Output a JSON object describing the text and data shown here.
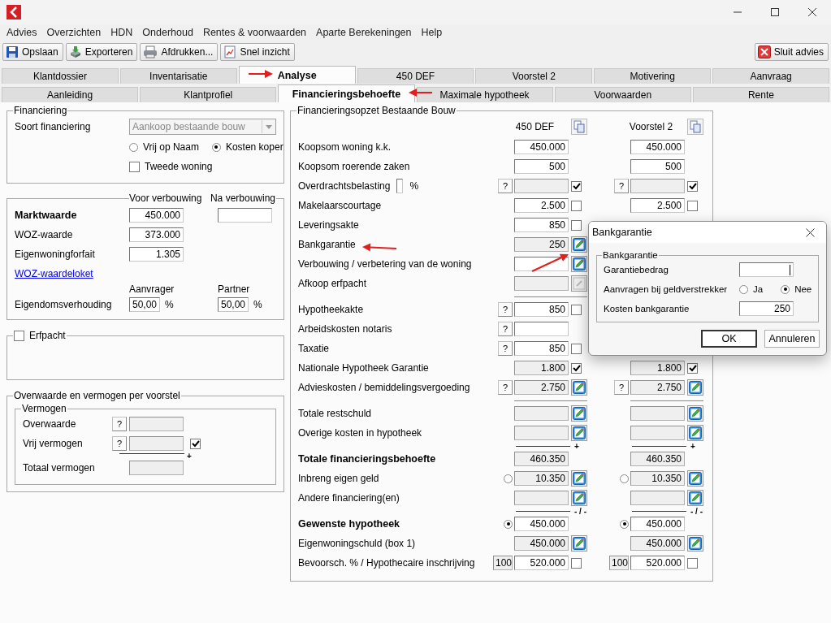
{
  "menu": [
    "Advies",
    "Overzichten",
    "HDN",
    "Onderhoud",
    "Rentes & voorwaarden",
    "Aparte Berekeningen",
    "Help"
  ],
  "toolbar": [
    {
      "label": "Opslaan"
    },
    {
      "label": "Exporteren"
    },
    {
      "label": "Afdrukken..."
    },
    {
      "label": "Snel inzicht"
    }
  ],
  "close_advice": {
    "label": "Sluit advies"
  },
  "tabs": [
    {
      "label": "Klantdossier",
      "selected": false
    },
    {
      "label": "Inventarisatie",
      "selected": false
    },
    {
      "label": "Analyse",
      "selected": true
    },
    {
      "label": "450 DEF",
      "selected": false
    },
    {
      "label": "Voorstel 2",
      "selected": false
    },
    {
      "label": "Motivering",
      "selected": false
    },
    {
      "label": "Aanvraag",
      "selected": false
    }
  ],
  "subtabs": [
    {
      "label": "Aanleiding",
      "selected": false
    },
    {
      "label": "Klantprofiel",
      "selected": false
    },
    {
      "label": "Financieringsbehoefte",
      "selected": true
    },
    {
      "label": "Maximale hypotheek",
      "selected": false
    },
    {
      "label": "Voorwaarden",
      "selected": false
    },
    {
      "label": "Rente",
      "selected": false
    }
  ],
  "financiering": {
    "title": "Financiering",
    "soort_label": "Soort financiering",
    "soort_value": "Aankoop bestaande bouw",
    "options": [
      {
        "label": "Vrij op Naam",
        "selected": false
      },
      {
        "label": "Kosten koper",
        "selected": true
      }
    ],
    "tweede_woning": {
      "label": "Tweede woning",
      "checked": false
    }
  },
  "waarde": {
    "voor_label": "Voor verbouwing",
    "na_label": "Na verbouwing",
    "marktwaarde": {
      "label": "Marktwaarde",
      "value": "450.000"
    },
    "woz": {
      "label": "WOZ-waarde",
      "value": "373.000"
    },
    "forfait": {
      "label": "Eigenwoningforfait",
      "value": "1.305"
    },
    "link": "WOZ-waardeloket",
    "eigendom": {
      "label": "Eigendomsverhouding",
      "aanvrager": {
        "label": "Aanvrager",
        "value": "50,00",
        "unit": "%"
      },
      "partner": {
        "label": "Partner",
        "value": "50,00",
        "unit": "%"
      }
    }
  },
  "erfpacht": {
    "label": "Erfpacht",
    "checked": false
  },
  "overwaarde": {
    "title": "Overwaarde en vermogen per voorstel",
    "group": "Vermogen",
    "overwaarde": {
      "label": "Overwaarde",
      "help": "?"
    },
    "vrij": {
      "label": "Vrij vermogen",
      "help": "?",
      "checked": true,
      "operator": "+"
    },
    "totaal": {
      "label": "Totaal vermogen"
    }
  },
  "opzet": {
    "title": "Financieringsopzet Bestaande Bouw",
    "columns": [
      {
        "name": "450 DEF"
      },
      {
        "name": "Voorstel 2"
      }
    ],
    "rows": [
      {
        "kind": "item",
        "label": "Koopsom woning k.k.",
        "cells": [
          {
            "field": {
              "kind": "input",
              "value": "450.000"
            }
          },
          {
            "field": {
              "kind": "input",
              "value": "450.000"
            }
          }
        ]
      },
      {
        "kind": "item",
        "label": "Koopsom roerende zaken",
        "cells": [
          {
            "field": {
              "kind": "input",
              "value": "500"
            }
          },
          {
            "field": {
              "kind": "input",
              "value": "500"
            }
          }
        ]
      },
      {
        "kind": "item",
        "label": "Overdrachtsbelasting",
        "percent_field": {
          "unit": "%"
        },
        "cells": [
          {
            "prefix": {
              "kind": "help",
              "text": "?"
            },
            "field": {
              "kind": "readonly"
            },
            "suffix": {
              "kind": "checkbox",
              "checked": true
            }
          },
          {
            "prefix": {
              "kind": "help",
              "text": "?"
            },
            "field": {
              "kind": "readonly"
            },
            "suffix": {
              "kind": "checkbox",
              "checked": true
            }
          }
        ]
      },
      {
        "kind": "item",
        "label": "Makelaarscourtage",
        "cells": [
          {
            "field": {
              "kind": "input",
              "value": "2.500"
            },
            "suffix": {
              "kind": "checkbox",
              "checked": false
            }
          },
          {
            "field": {
              "kind": "input",
              "value": "2.500"
            },
            "suffix": {
              "kind": "checkbox",
              "checked": false
            }
          }
        ]
      },
      {
        "kind": "item",
        "label": "Leveringsakte",
        "cells": [
          {
            "field": {
              "kind": "input",
              "value": "850"
            },
            "suffix": {
              "kind": "checkbox",
              "checked": false
            }
          },
          null
        ]
      },
      {
        "kind": "item",
        "label": "Bankgarantie",
        "cells": [
          {
            "field": {
              "kind": "readonly",
              "value": "250"
            },
            "suffix": {
              "kind": "edit",
              "disabled": false
            }
          },
          null
        ]
      },
      {
        "kind": "item",
        "label": "Verbouwing / verbetering van de woning",
        "cells": [
          {
            "field": {
              "kind": "input"
            },
            "suffix": {
              "kind": "edit",
              "disabled": false
            }
          },
          null
        ]
      },
      {
        "kind": "item",
        "label": "Afkoop erfpacht",
        "cells": [
          {
            "field": {
              "kind": "readonly"
            },
            "suffix": {
              "kind": "edit",
              "disabled": true
            }
          },
          null
        ]
      },
      {
        "kind": "separator",
        "cells": [
          {
            "kind": "line"
          },
          null
        ]
      },
      {
        "kind": "item",
        "label": "Hypotheekakte",
        "cells": [
          {
            "prefix": {
              "kind": "help",
              "text": "?"
            },
            "field": {
              "kind": "input",
              "value": "850"
            },
            "suffix": {
              "kind": "checkbox",
              "checked": false
            }
          },
          null
        ]
      },
      {
        "kind": "item",
        "label": "Arbeidskosten notaris",
        "cells": [
          {
            "prefix": {
              "kind": "help",
              "text": "?"
            },
            "field": {
              "kind": "input"
            }
          },
          null
        ]
      },
      {
        "kind": "item",
        "label": "Taxatie",
        "cells": [
          {
            "prefix": {
              "kind": "help",
              "text": "?"
            },
            "field": {
              "kind": "input",
              "value": "850"
            },
            "suffix": {
              "kind": "checkbox",
              "checked": false
            }
          },
          null
        ]
      },
      {
        "kind": "item",
        "label": "Nationale Hypotheek Garantie",
        "cells": [
          {
            "field": {
              "kind": "readonly",
              "value": "1.800"
            },
            "suffix": {
              "kind": "checkbox",
              "checked": true
            }
          },
          {
            "field": {
              "kind": "readonly",
              "value": "1.800"
            },
            "suffix": {
              "kind": "checkbox",
              "checked": true
            }
          }
        ]
      },
      {
        "kind": "item",
        "label": "Advieskosten / bemiddelingsvergoeding",
        "cells": [
          {
            "prefix": {
              "kind": "help",
              "text": "?"
            },
            "field": {
              "kind": "readonly",
              "value": "2.750"
            },
            "suffix": {
              "kind": "edit",
              "disabled": false
            }
          },
          {
            "prefix": {
              "kind": "help",
              "text": "?"
            },
            "field": {
              "kind": "readonly",
              "value": "2.750"
            },
            "suffix": {
              "kind": "edit",
              "disabled": false
            }
          }
        ]
      },
      {
        "kind": "separator",
        "cells": [
          {
            "kind": "line"
          },
          {
            "kind": "line"
          }
        ]
      },
      {
        "kind": "item",
        "label": "Totale restschuld",
        "cells": [
          {
            "field": {
              "kind": "readonly"
            },
            "suffix": {
              "kind": "edit",
              "disabled": false
            }
          },
          {
            "field": {
              "kind": "readonly"
            },
            "suffix": {
              "kind": "edit",
              "disabled": false
            }
          }
        ]
      },
      {
        "kind": "item",
        "label": "Overige kosten in hypotheek",
        "cells": [
          {
            "field": {
              "kind": "readonly"
            },
            "suffix": {
              "kind": "edit",
              "disabled": false
            }
          },
          {
            "field": {
              "kind": "readonly"
            },
            "suffix": {
              "kind": "edit",
              "disabled": false
            }
          }
        ]
      },
      {
        "kind": "separator",
        "cells": [
          {
            "kind": "line",
            "operator": "+"
          },
          {
            "kind": "line",
            "operator": "+"
          }
        ]
      },
      {
        "kind": "total",
        "label": "Totale financieringsbehoefte",
        "cells": [
          {
            "field": {
              "kind": "readonly",
              "value": "460.350"
            }
          },
          {
            "field": {
              "kind": "readonly",
              "value": "460.350"
            }
          }
        ]
      },
      {
        "kind": "item",
        "label": "Inbreng eigen geld",
        "cells": [
          {
            "prefix": {
              "kind": "radio",
              "selected": false
            },
            "field": {
              "kind": "readonly",
              "value": "10.350"
            },
            "suffix": {
              "kind": "edit",
              "disabled": false
            }
          },
          {
            "prefix": {
              "kind": "radio",
              "selected": false
            },
            "field": {
              "kind": "readonly",
              "value": "10.350"
            },
            "suffix": {
              "kind": "edit",
              "disabled": false
            }
          }
        ]
      },
      {
        "kind": "item",
        "label": "Andere financiering(en)",
        "cells": [
          {
            "field": {
              "kind": "readonly"
            },
            "suffix": {
              "kind": "edit",
              "disabled": false
            }
          },
          {
            "field": {
              "kind": "readonly"
            },
            "suffix": {
              "kind": "edit",
              "disabled": false
            }
          }
        ]
      },
      {
        "kind": "separator",
        "cells": [
          {
            "kind": "line",
            "operator": "- / -"
          },
          {
            "kind": "line",
            "operator": "- / -"
          }
        ]
      },
      {
        "kind": "total",
        "label": "Gewenste hypotheek",
        "cells": [
          {
            "prefix": {
              "kind": "radio",
              "selected": true
            },
            "field": {
              "kind": "input",
              "value": "450.000"
            }
          },
          {
            "prefix": {
              "kind": "radio",
              "selected": true
            },
            "field": {
              "kind": "input",
              "value": "450.000"
            }
          }
        ]
      },
      {
        "kind": "item",
        "label": "Eigenwoningschuld (box 1)",
        "cells": [
          {
            "field": {
              "kind": "readonly",
              "value": "450.000"
            },
            "suffix": {
              "kind": "edit",
              "disabled": false
            }
          },
          {
            "field": {
              "kind": "readonly",
              "value": "450.000"
            },
            "suffix": {
              "kind": "edit",
              "disabled": false
            }
          }
        ]
      },
      {
        "kind": "item",
        "label": "Bevoorsch. % / Hypothecaire inschrijving",
        "cells": [
          {
            "prefix": {
              "kind": "percent",
              "text": "100"
            },
            "field": {
              "kind": "input",
              "value": "520.000"
            },
            "suffix": {
              "kind": "checkbox",
              "checked": false
            }
          },
          {
            "prefix": {
              "kind": "percent",
              "text": "100"
            },
            "field": {
              "kind": "input",
              "value": "520.000"
            },
            "suffix": {
              "kind": "checkbox",
              "checked": false
            }
          }
        ]
      }
    ]
  },
  "dialog": {
    "title": "Bankgarantie",
    "group": "Bankgarantie",
    "garantie": {
      "label": "Garantiebedrag"
    },
    "aanvragen": {
      "label": "Aanvragen bij geldverstrekker",
      "options": [
        {
          "label": "Ja",
          "selected": false
        },
        {
          "label": "Nee",
          "selected": true
        }
      ]
    },
    "kosten": {
      "label": "Kosten bankgarantie",
      "value": "250"
    },
    "buttons": [
      {
        "label": "OK",
        "default": true
      },
      {
        "label": "Annuleren",
        "default": false
      }
    ]
  }
}
